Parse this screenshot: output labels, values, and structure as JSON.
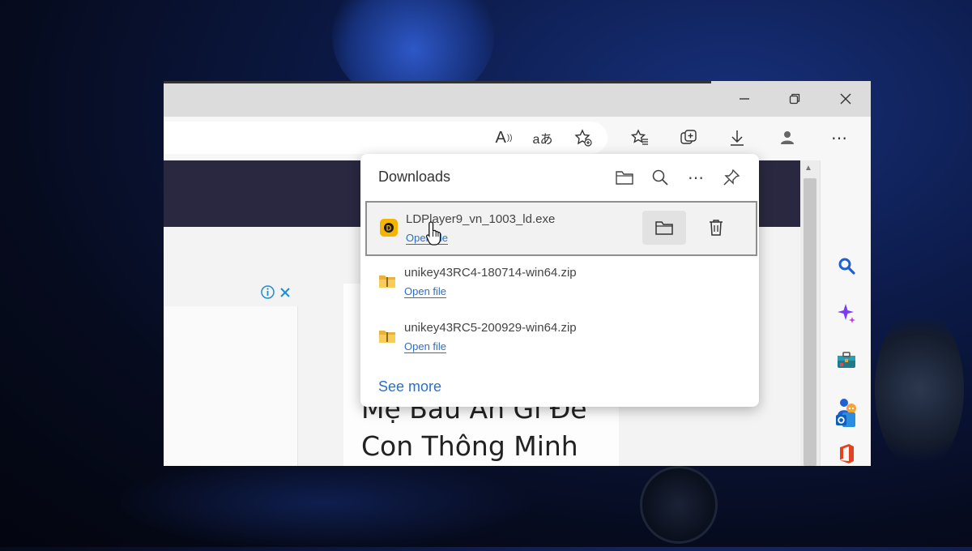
{
  "browser": {
    "window_controls": {
      "minimize_icon": "minimize-icon",
      "restore_icon": "restore-icon",
      "close_icon": "close-icon"
    },
    "toolbar_icons": [
      "read-aloud-icon",
      "translate-icon",
      "add-favorite-icon",
      "favorites-icon",
      "collections-icon",
      "downloads-icon",
      "profile-icon",
      "more-icon"
    ],
    "read_aloud_label": "A",
    "translate_label": "aあ"
  },
  "downloads_panel": {
    "title": "Downloads",
    "header_icons": [
      "open-folder-icon",
      "search-icon",
      "more-options-icon",
      "pin-icon"
    ],
    "items": [
      {
        "file_name": "LDPlayer9_vn_1003_ld.exe",
        "action_link": "Open file",
        "file_icon": "ldplayer-app-icon",
        "actions": [
          "show-in-folder-icon",
          "delete-icon"
        ]
      },
      {
        "file_name": "unikey43RC4-180714-win64.zip",
        "action_link": "Open file",
        "file_icon": "zip-folder-icon"
      },
      {
        "file_name": "unikey43RC5-200929-win64.zip",
        "action_link": "Open file",
        "file_icon": "zip-folder-icon"
      }
    ],
    "see_more": "See more"
  },
  "page": {
    "article_title_line1": "Mẹ Bầu Ăn Gì Để",
    "article_title_line2": "Con Thông Minh"
  },
  "sidebar_icons": [
    "search-icon",
    "copilot-icon",
    "tools-icon",
    "games-icon",
    "office-icon",
    "outlook-icon"
  ],
  "colors": {
    "accent": "#2a6fc9",
    "navy_banner": "#2a2840",
    "ld_yellow": "#f4b400"
  }
}
